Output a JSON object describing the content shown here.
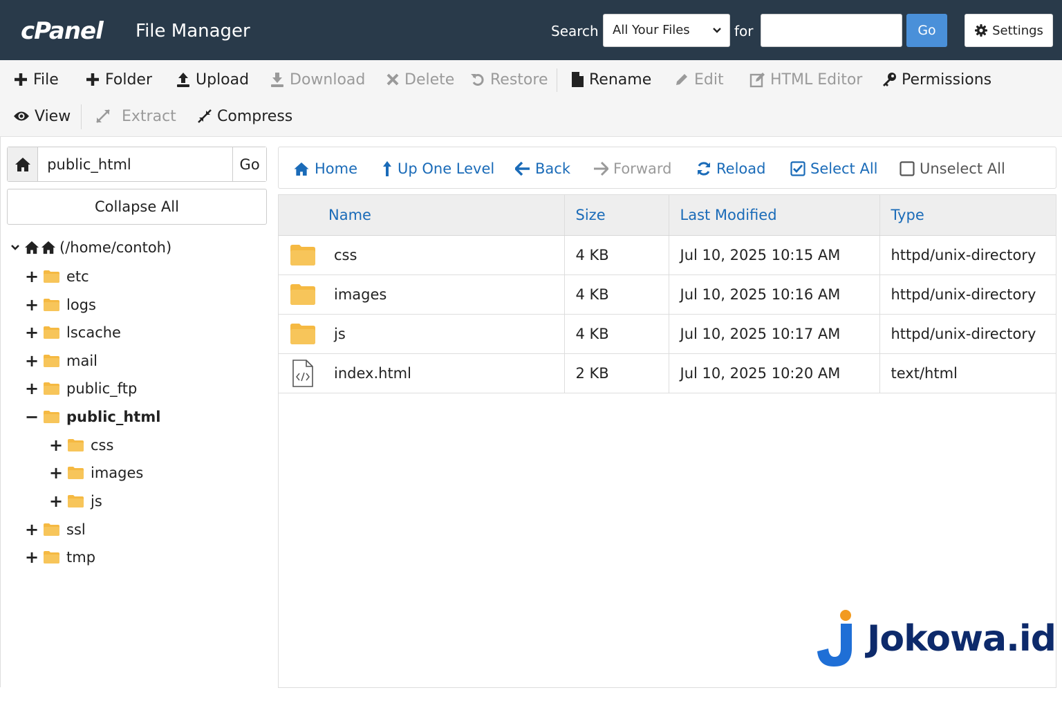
{
  "header": {
    "logo": "cPanel",
    "app_title": "File Manager",
    "search_label": "Search",
    "search_scope": "All Your Files",
    "for_label": "for",
    "search_value": "",
    "search_go": "Go",
    "settings_label": "Settings"
  },
  "toolbar": {
    "file": "File",
    "folder": "Folder",
    "upload": "Upload",
    "download": "Download",
    "delete": "Delete",
    "restore": "Restore",
    "rename": "Rename",
    "edit": "Edit",
    "html_editor": "HTML Editor",
    "permissions": "Permissions",
    "view": "View",
    "extract": "Extract",
    "compress": "Compress"
  },
  "sidebar": {
    "path_value": "public_html",
    "path_go": "Go",
    "collapse_all": "Collapse All",
    "root_label": "(/home/contoh)",
    "tree": [
      {
        "label": "etc",
        "toggle": "+"
      },
      {
        "label": "logs",
        "toggle": "+"
      },
      {
        "label": "lscache",
        "toggle": "+"
      },
      {
        "label": "mail",
        "toggle": "+"
      },
      {
        "label": "public_ftp",
        "toggle": "+"
      },
      {
        "label": "public_html",
        "toggle": "−"
      },
      {
        "label": "css",
        "toggle": "+"
      },
      {
        "label": "images",
        "toggle": "+"
      },
      {
        "label": "js",
        "toggle": "+"
      },
      {
        "label": "ssl",
        "toggle": "+"
      },
      {
        "label": "tmp",
        "toggle": "+"
      }
    ]
  },
  "navbar": {
    "home": "Home",
    "up_one_level": "Up One Level",
    "back": "Back",
    "forward": "Forward",
    "reload": "Reload",
    "select_all": "Select All",
    "unselect_all": "Unselect All"
  },
  "table": {
    "headers": {
      "name": "Name",
      "size": "Size",
      "modified": "Last Modified",
      "type": "Type"
    },
    "rows": [
      {
        "name": "css",
        "size": "4 KB",
        "modified": "Jul 10, 2025 10:15 AM",
        "type": "httpd/unix-directory",
        "icon": "folder-icon"
      },
      {
        "name": "images",
        "size": "4 KB",
        "modified": "Jul 10, 2025 10:16 AM",
        "type": "httpd/unix-directory",
        "icon": "folder-icon"
      },
      {
        "name": "js",
        "size": "4 KB",
        "modified": "Jul 10, 2025 10:17 AM",
        "type": "httpd/unix-directory",
        "icon": "folder-icon"
      },
      {
        "name": "index.html",
        "size": "2 KB",
        "modified": "Jul 10, 2025 10:20 AM",
        "type": "text/html",
        "icon": "html-file-icon"
      }
    ]
  },
  "watermark": {
    "brand": "Jokowa.id"
  },
  "colors": {
    "header_bg": "#293a4a",
    "accent_blue": "#1a6bb8",
    "go_button": "#4a90d9",
    "folder_yellow": "#f5b942",
    "brand_navy": "#0d2a6b"
  }
}
